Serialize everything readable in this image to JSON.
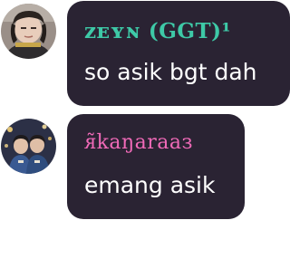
{
  "messages": [
    {
      "sender": "ᴢᴇʏɴ (GGT)¹",
      "sender_color": "#3ec9a7",
      "text": "so asik bgt dah"
    },
    {
      "sender": "ᴙ̃kaŋaraaз",
      "sender_color": "#f06ab8",
      "text": "emang asik"
    }
  ],
  "colors": {
    "bubble_background": "#2a2333",
    "message_text": "#ffffff",
    "page_background": "#ffffff"
  }
}
